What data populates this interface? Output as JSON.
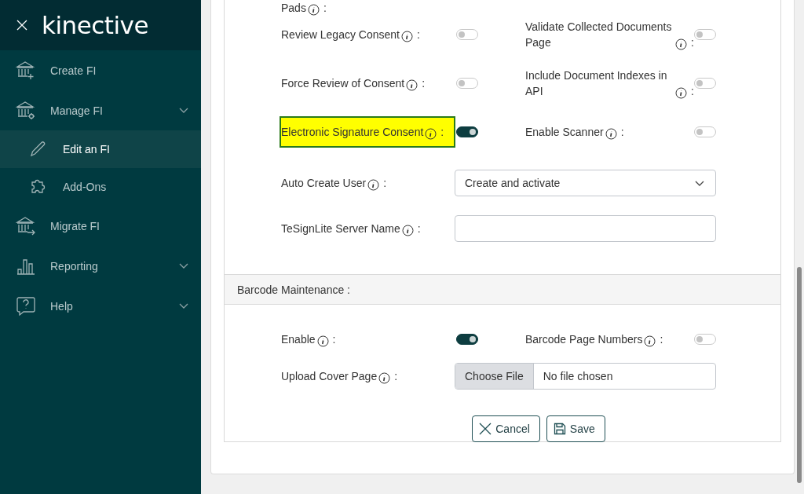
{
  "sidebar": {
    "logo": "kinective",
    "items": [
      {
        "label": "Create FI",
        "kind": "bank-plus",
        "expandable": false,
        "selected": false
      },
      {
        "label": "Manage FI",
        "kind": "bank-gear",
        "expandable": true,
        "selected": false,
        "children": [
          {
            "label": "Edit an FI",
            "kind": "pencil",
            "selected": true
          },
          {
            "label": "Add-Ons",
            "kind": "puzzle",
            "selected": false
          }
        ]
      },
      {
        "label": "Migrate FI",
        "kind": "bank-arrow",
        "expandable": false,
        "selected": false
      },
      {
        "label": "Reporting",
        "kind": "chart",
        "expandable": true,
        "selected": false
      },
      {
        "label": "Help",
        "kind": "help",
        "expandable": true,
        "selected": false
      }
    ]
  },
  "form": {
    "cut_label": "Pads",
    "cut_suffix": ":",
    "toggle_rows": [
      {
        "left": {
          "label": "Review Legacy Consent",
          "suffix": ":",
          "on": false,
          "highlighted": false
        },
        "right": {
          "label": "Validate Collected Documents Page",
          "suffix": ":",
          "on": false,
          "highlighted": false
        }
      },
      {
        "left": {
          "label": "Force Review of Consent",
          "suffix": ":",
          "on": false,
          "highlighted": false
        },
        "right": {
          "label": "Include Document Indexes in API",
          "suffix": ":",
          "on": false,
          "highlighted": false
        }
      },
      {
        "left": {
          "label": "Electronic Signature Consent",
          "suffix": ":",
          "on": true,
          "highlighted": true
        },
        "right": {
          "label": "Enable Scanner",
          "suffix": ":",
          "on": false,
          "highlighted": false
        }
      }
    ],
    "fields": [
      {
        "label": "Auto Create User",
        "suffix": ":",
        "kind": "select",
        "value": "Create and activate"
      },
      {
        "label": "TeSignLite Server Name",
        "suffix": ":",
        "kind": "text"
      }
    ]
  },
  "barcode": {
    "title": "Barcode Maintenance :",
    "toggle_rows": [
      {
        "left": {
          "label": "Enable",
          "suffix": ":",
          "on": true,
          "highlighted": false
        },
        "right": {
          "label": "Barcode Page Numbers",
          "suffix": ":",
          "on": false,
          "highlighted": false
        }
      }
    ],
    "fields": [
      {
        "label": "Upload Cover Page",
        "suffix": ":",
        "kind": "file",
        "button": "Choose File",
        "status": "No file chosen"
      }
    ]
  },
  "buttons": [
    {
      "label": "Cancel",
      "kind": "cancel"
    },
    {
      "label": "Save",
      "kind": "save"
    }
  ]
}
